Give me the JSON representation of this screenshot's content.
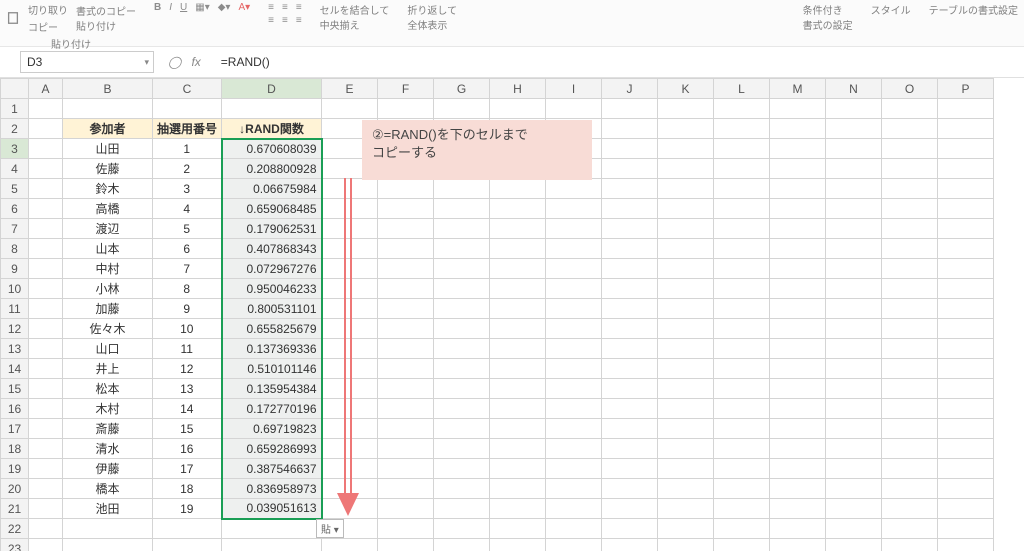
{
  "ribbon": {
    "paste": "貼り付け",
    "copy": "コピー",
    "cut": "切り取り",
    "format_painter": "書式のコピー\n貼り付け",
    "merge": "セルを結合して\n中央揃え",
    "wrap": "折り返して\n全体表示",
    "cond_format": "条件付き\n書式の設定",
    "styles": "スタイル",
    "table_format": "テーブルの書式設定"
  },
  "namebox": "D3",
  "fx_label": "fx",
  "formula": "=RAND()",
  "col_headers": [
    "A",
    "B",
    "C",
    "D",
    "E",
    "F",
    "G",
    "H",
    "I",
    "J",
    "K",
    "L",
    "M",
    "N",
    "O",
    "P"
  ],
  "header_row": {
    "B": "参加者",
    "C": "抽選用番号",
    "D": "↓RAND関数"
  },
  "rows": [
    {
      "n": 3,
      "b": "山田",
      "c": 1,
      "d": "0.670608039"
    },
    {
      "n": 4,
      "b": "佐藤",
      "c": 2,
      "d": "0.208800928"
    },
    {
      "n": 5,
      "b": "鈴木",
      "c": 3,
      "d": "0.06675984"
    },
    {
      "n": 6,
      "b": "高橋",
      "c": 4,
      "d": "0.659068485"
    },
    {
      "n": 7,
      "b": "渡辺",
      "c": 5,
      "d": "0.179062531"
    },
    {
      "n": 8,
      "b": "山本",
      "c": 6,
      "d": "0.407868343"
    },
    {
      "n": 9,
      "b": "中村",
      "c": 7,
      "d": "0.072967276"
    },
    {
      "n": 10,
      "b": "小林",
      "c": 8,
      "d": "0.950046233"
    },
    {
      "n": 11,
      "b": "加藤",
      "c": 9,
      "d": "0.800531101"
    },
    {
      "n": 12,
      "b": "佐々木",
      "c": 10,
      "d": "0.655825679"
    },
    {
      "n": 13,
      "b": "山口",
      "c": 11,
      "d": "0.137369336"
    },
    {
      "n": 14,
      "b": "井上",
      "c": 12,
      "d": "0.510101146"
    },
    {
      "n": 15,
      "b": "松本",
      "c": 13,
      "d": "0.135954384"
    },
    {
      "n": 16,
      "b": "木村",
      "c": 14,
      "d": "0.172770196"
    },
    {
      "n": 17,
      "b": "斎藤",
      "c": 15,
      "d": "0.69719823"
    },
    {
      "n": 18,
      "b": "清水",
      "c": 16,
      "d": "0.659286993"
    },
    {
      "n": 19,
      "b": "伊藤",
      "c": 17,
      "d": "0.387546637"
    },
    {
      "n": 20,
      "b": "橋本",
      "c": 18,
      "d": "0.836958973"
    },
    {
      "n": 21,
      "b": "池田",
      "c": 19,
      "d": "0.039051613"
    }
  ],
  "extra_rows": [
    22,
    23
  ],
  "callout": {
    "line1": "②=RAND()を下のセルまで",
    "line2": "コピーする"
  },
  "autofill_tag": "貼"
}
